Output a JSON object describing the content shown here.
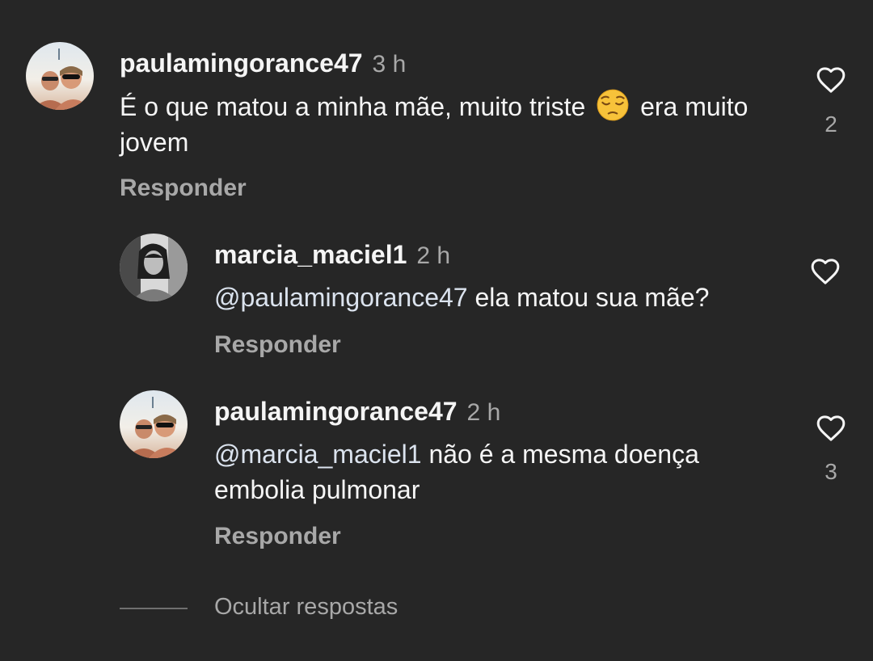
{
  "comments": [
    {
      "username": "paulamingorance47",
      "time": "3 h",
      "text_before": "É o que matou a minha mãe, muito triste",
      "emoji": "pensive-face",
      "text_after": "era muito jovem",
      "reply_label": "Responder",
      "like_count": "2"
    },
    {
      "username": "marcia_maciel1",
      "time": "2 h",
      "mention": "@paulamingorance47",
      "text": "ela matou sua mãe?",
      "reply_label": "Responder"
    },
    {
      "username": "paulamingorance47",
      "time": "2 h",
      "mention": "@marcia_maciel1",
      "text": "não é a mesma doença embolia pulmonar",
      "reply_label": "Responder",
      "like_count": "3"
    }
  ],
  "hide_replies_label": "Ocultar respostas",
  "icons": {
    "like": "heart-outline-icon"
  },
  "colors": {
    "background": "#262626",
    "primary_text": "#f5f5f5",
    "secondary_text": "#a8a8a8",
    "mention": "#dbe3ee"
  }
}
